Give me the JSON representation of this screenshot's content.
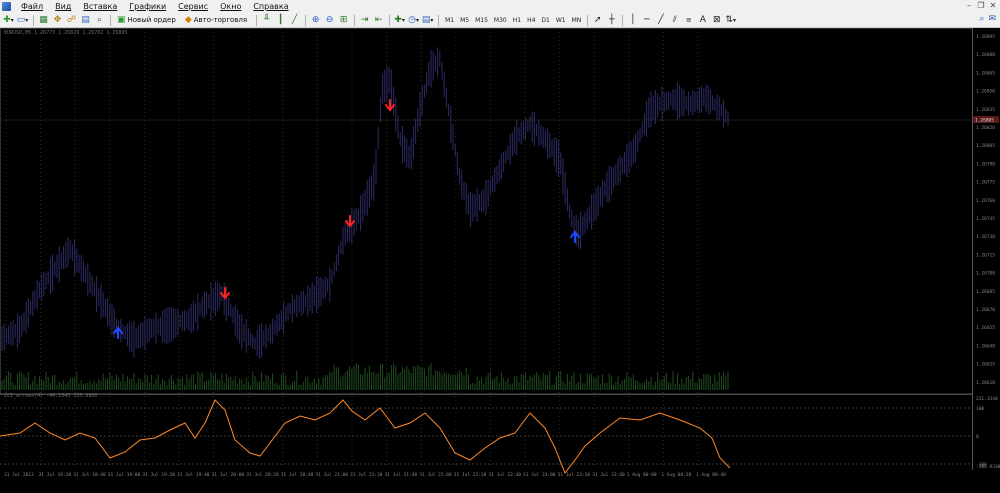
{
  "menu": {
    "items": [
      "Файл",
      "Вид",
      "Вставка",
      "Графики",
      "Сервис",
      "Окно",
      "Справка"
    ]
  },
  "toolbar": {
    "new_order_label": "Новый ордер",
    "auto_trading_label": "Авто-торговля",
    "timeframes": [
      "M1",
      "M5",
      "M15",
      "M30",
      "H1",
      "H4",
      "D1",
      "W1",
      "MN"
    ]
  },
  "chart": {
    "info_line": "EURUSD,M5  1.26773  1.26829  1.26762  1.26805",
    "indicator_label": "CCI_arrows(4)  -44.1543  135.9906",
    "price_labels": [
      "1.26895",
      "1.26880",
      "1.26865",
      "1.26850",
      "1.26835",
      "1.26820",
      "1.26805",
      "1.26790",
      "1.26775",
      "1.26760",
      "1.26745",
      "1.26730",
      "1.26715",
      "1.26700",
      "1.26685",
      "1.26670",
      "1.26655",
      "1.26640",
      "1.26625",
      "1.26610"
    ],
    "current_price": "1.26805",
    "indicator_levels": [
      "231.3340",
      "100",
      "0",
      "-100",
      "-206.9330"
    ],
    "time_labels": [
      "31 Jul 2013",
      "31 Jul 18:20",
      "31 Jul 18:40",
      "31 Jul 19:00",
      "31 Jul 19:20",
      "31 Jul 19:40",
      "31 Jul 20:00",
      "31 Jul 20:20",
      "31 Jul 20:40",
      "31 Jul 21:00",
      "31 Jul 21:20",
      "31 Jul 21:40",
      "31 Jul 22:00",
      "31 Jul 22:20",
      "31 Jul 22:40",
      "31 Jul 23:00",
      "31 Jul 23:20",
      "31 Jul 23:40",
      "1 Aug 00:00",
      "1 Aug 00:20",
      "1 Aug 00:40"
    ],
    "colors": {
      "candles": "#2c2c66",
      "volume": "#1f4d1f",
      "cci_line": "#ff8a2a",
      "arrow_down": "#ff2020",
      "arrow_up": "#2048ff",
      "grid": "#2a2a2a",
      "axis_text": "#888888"
    }
  }
}
